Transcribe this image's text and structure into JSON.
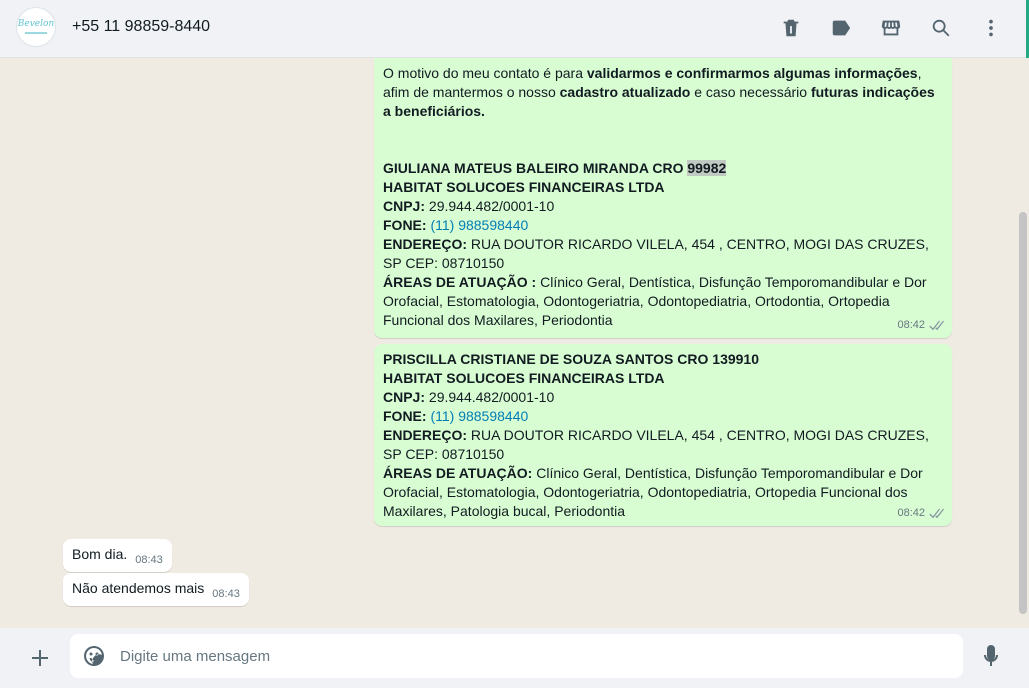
{
  "header": {
    "avatar_logo": "Bevelon",
    "contact": "+55 11 98859-8440"
  },
  "messages": {
    "m1": {
      "intro_a": "O motivo do meu contato é para ",
      "intro_b": "validarmos e confirmarmos algumas informações",
      "intro_c": ", afim de mantermos o nosso ",
      "intro_d": "cadastro atualizado",
      "intro_e": " e caso necessário ",
      "intro_f": "futuras indicações a beneficiários.",
      "name": "GIULIANA MATEUS BALEIRO MIRANDA CRO ",
      "cro": "99982",
      "company": "HABITAT SOLUCOES FINANCEIRAS LTDA",
      "cnpj_label": "CNPJ:",
      "cnpj": " 29.944.482/0001-10",
      "fone_label": "FONE:",
      "fone": "(11) 988598440",
      "end_label": "ENDEREÇO:",
      "end": " RUA DOUTOR RICARDO VILELA, 454 , CENTRO, MOGI DAS CRUZES, SP CEP: 08710150",
      "areas_label": "ÁREAS DE ATUAÇÃO :",
      "areas": " Clínico Geral, Dentística, Disfunção Temporomandibular e Dor Orofacial, Estomatologia, Odontogeriatria, Odontopediatria, Ortodontia, Ortopedia Funcional dos Maxilares, Periodontia",
      "time": "08:42"
    },
    "m2": {
      "name": "PRISCILLA CRISTIANE DE SOUZA SANTOS CRO 139910",
      "company": "HABITAT SOLUCOES FINANCEIRAS LTDA",
      "cnpj_label": "CNPJ:",
      "cnpj": " 29.944.482/0001-10",
      "fone_label": "FONE:",
      "fone": "(11) 988598440",
      "end_label": "ENDEREÇO:",
      "end": " RUA DOUTOR RICARDO VILELA, 454 , CENTRO, MOGI DAS CRUZES, SP CEP: 08710150",
      "areas_label": "ÁREAS DE ATUAÇÃO:",
      "areas": " Clínico Geral, Dentística, Disfunção Temporomandibular e Dor Orofacial, Estomatologia, Odontogeriatria, Odontopediatria, Ortopedia Funcional dos Maxilares, Patologia bucal, Periodontia",
      "time": "08:42"
    },
    "m3": {
      "text": "Bom dia.",
      "time": "08:43"
    },
    "m4": {
      "text": "Não atendemos mais",
      "time": "08:43"
    }
  },
  "composer": {
    "placeholder": "Digite uma mensagem"
  }
}
